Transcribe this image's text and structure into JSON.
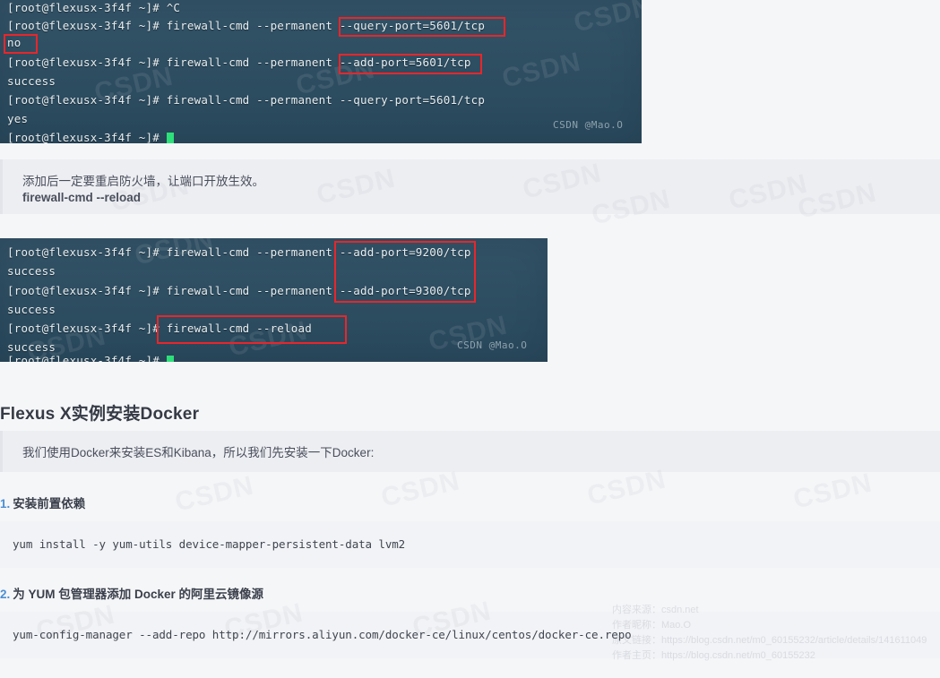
{
  "page": {
    "background": "#f5f6f8",
    "terminal_bg": "#2b4c61",
    "accent_blue": "#4d8fd4",
    "highlight_red": "#e8262a"
  },
  "terminal_1": {
    "watermark": "CSDN @Mao.O",
    "lines": [
      "[root@flexusx-3f4f ~]# ^C",
      "[root@flexusx-3f4f ~]# firewall-cmd --permanent --query-port=5601/tcp",
      "no",
      "[root@flexusx-3f4f ~]# firewall-cmd --permanent --add-port=5601/tcp",
      "success",
      "[root@flexusx-3f4f ~]# firewall-cmd --permanent --query-port=5601/tcp",
      "yes",
      "[root@flexusx-3f4f ~]# "
    ],
    "highlights": [
      "--query-port=5601/tcp",
      "no",
      "--add-port=5601/tcp"
    ]
  },
  "note_1": {
    "line1": "添加后一定要重启防火墙，让端口开放生效。",
    "line2": "firewall-cmd --reload"
  },
  "terminal_2": {
    "watermark": "CSDN @Mao.O",
    "lines": [
      "[root@flexusx-3f4f ~]# firewall-cmd --permanent --add-port=9200/tcp",
      "success",
      "[root@flexusx-3f4f ~]# firewall-cmd --permanent --add-port=9300/tcp",
      "success",
      "[root@flexusx-3f4f ~]# firewall-cmd --reload",
      "success",
      "[root@flexusx-3f4f ~]# "
    ],
    "highlights": [
      "--add-port=9200/tcp  /  --add-port=9300/tcp",
      "firewall-cmd --reload"
    ]
  },
  "heading_docker": "Flexus X实例安装Docker",
  "note_2": {
    "line1": "我们使用Docker来安装ES和Kibana，所以我们先安装一下Docker:"
  },
  "steps": [
    {
      "number": "1.",
      "title": "安装前置依赖",
      "code": "yum install -y yum-utils device-mapper-persistent-data lvm2"
    },
    {
      "number": "2.",
      "title": "为 YUM 包管理器添加 Docker 的阿里云镜像源",
      "code": "yum-config-manager --add-repo http://mirrors.aliyun.com/docker-ce/linux/centos/docker-ce.repo"
    }
  ],
  "provenance": {
    "source_label": "内容来源：csdn.net",
    "author_label": "作者昵称：Mao.O",
    "article_link": "原文链接：https://blog.csdn.net/m0_60155232/article/details/141611049",
    "author_home": "作者主页：https://blog.csdn.net/m0_60155232"
  },
  "watermark_text": "CSDN"
}
